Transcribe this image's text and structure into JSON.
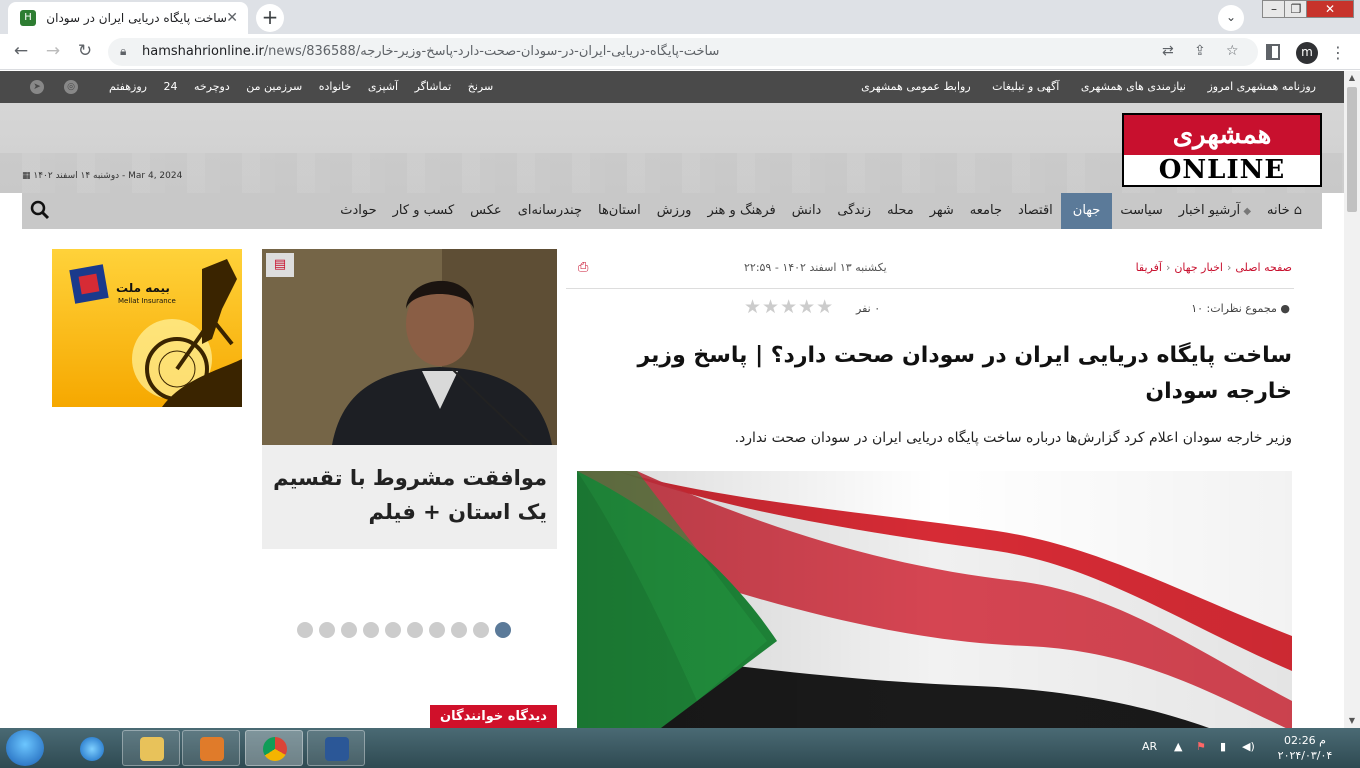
{
  "browser": {
    "tab_title": "ساخت پایگاه دریایی ایران در سودان صحت",
    "url_host": "hamshahrionline.ir",
    "url_path": "/news/836588/ساخت-پایگاه-دریایی-ایران-در-سودان-صحت-دارد-پاسخ-وزیر-خارجه",
    "profile_initial": "m"
  },
  "site_topbar": {
    "right_links": [
      "روزنامه همشهری امروز",
      "نیازمندی های همشهری",
      "آگهی و تبلیغات",
      "روابط عمومی همشهری"
    ],
    "left_links": [
      "سرنخ",
      "تماشاگر",
      "آشپزی",
      "خانواده",
      "سرزمین من",
      "دوچرخه",
      "24",
      "روزهفتم"
    ]
  },
  "header": {
    "logo_top": "همشهری",
    "logo_bottom": "ONLINE",
    "date": "دوشنبه ۱۴ اسفند ۱۴۰۲ - Mar 4, 2024"
  },
  "nav": {
    "items": [
      "خانه",
      "آرشیو اخبار",
      "سیاست",
      "جهان",
      "اقتصاد",
      "جامعه",
      "شهر",
      "محله",
      "زندگی",
      "دانش",
      "فرهنگ و هنر",
      "ورزش",
      "استان‌ها",
      "چندرسانه‌ای",
      "عکس",
      "کسب و کار",
      "حوادث"
    ],
    "active": "جهان"
  },
  "article": {
    "breadcrumb": [
      "صفحه اصلی",
      "اخبار جهان",
      "آفریقا"
    ],
    "published": "یکشنبه ۱۳ اسفند ۱۴۰۲ - ۲۲:۵۹",
    "comments": "مجموع نظرات: ۱۰",
    "rating_count": "۰ نفر",
    "rating": 0,
    "headline": "ساخت پایگاه دریایی ایران در سودان صحت دارد؟ | پاسخ وزیر خارجه سودان",
    "lead": "وزیر خارجه سودان اعلام کرد گزارش‌ها درباره ساخت پایگاه دریایی ایران در سودان صحت ندارد."
  },
  "sidebox": {
    "caption": "موافقت مشروط با تقسیم یک استان + فیلم",
    "slides": 10,
    "active_slide": 1,
    "badge": "دیدگاه خوانندگان"
  },
  "ad": {
    "brand_fa": "بیمه ملت",
    "brand_en": "Mellat Insurance"
  },
  "taskbar": {
    "lang": "AR",
    "time": "م 02:26",
    "date": "۲۰۲۴/۰۳/۰۴"
  }
}
